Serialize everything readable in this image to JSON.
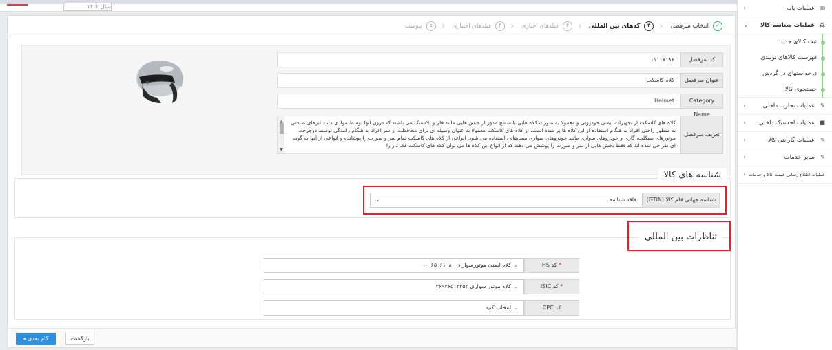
{
  "topbar": {
    "year_field": "سال ۱۴۰۲"
  },
  "sidebar": {
    "items": [
      {
        "label": "عملیات پایه",
        "icon": "chart-icon"
      },
      {
        "label": "عملیات شناسه کالا",
        "icon": "cubes-icon"
      },
      {
        "label": "عملیات تجارت داخلی",
        "icon": "edit-icon"
      },
      {
        "label": "عملیات لجستیک داخلی",
        "icon": "truck-icon"
      },
      {
        "label": "عملیات گارانتی کالا",
        "icon": "edit-icon"
      },
      {
        "label": "سایر خدمات",
        "icon": "edit-icon"
      },
      {
        "label": "عملیات اطلاع رسانی قیمت کالا و خدمات",
        "icon": ""
      }
    ],
    "sub_items": [
      "ثبت کالای جدید",
      "فهرست کالاهای تولیدی",
      "درخواستهای در گردش",
      "جستجوی کالا"
    ]
  },
  "wizard": {
    "steps": [
      {
        "num": "✓",
        "label": "انتخاب سرفصل"
      },
      {
        "num": "۲",
        "label": "کدهای بین المللی"
      },
      {
        "num": "۳",
        "label": "فیلدهای اجباری"
      },
      {
        "num": "۴",
        "label": "فیلدهای اختیاری"
      },
      {
        "num": "۵",
        "label": "پیوست"
      }
    ]
  },
  "info": {
    "code_label": "کد سرفصل",
    "code_value": "۱۱۱۱۷۱۸۶",
    "title_label": "عنوان سرفصل",
    "title_value": "کلاه کاسکت",
    "category_label": "Category Name",
    "category_value": "Helmet",
    "desc_label": "تعریف سرفصل",
    "desc_value": "کلاه های کاسکت از تجهیزات ایمنی خودرویی و معمولا به صورت کلاه هایی با سطح مدور از جنس هایی مانند فلز و پلاستیک می باشند که درون آنها توسط موادی مانند ابرهای صنعتی به منظور راحتی افراد به هنگام استفاده از این کلاه ها پر شده است. از کلاه های کاسکت معمولا به عنوان وسیله ای برای محافظت از سر افراد به هنگام رانندگی توسط دوچرخه، موتورهای سیکلت، گاری و خودروهای سواری مانند خودروهای سواری مسابقاتی استفاده می شود. انواعی از کلاه های کاسکت تمام سر و صورت را پوشانده و انواعی از آنها به گونه ای طراحی شده اند که فقط بخش هایی از سر و صورت را پوشش می دهند که از انواع این کلاه ها می توان کلاه های کاسکت فک دار را"
  },
  "identifiers": {
    "title": "شناسه های کالا",
    "gtin_label": "شناسه جهانی قلم کالا (GTIN)",
    "gtin_value": "فاقد شناسه"
  },
  "international": {
    "title": "تناظرات بین المللی",
    "hs_label": "کد HS",
    "hs_value": "کلاه ایمنی موتورسواران ۶۵۰۶۱۰۸۰ —",
    "isic_label": "کد ISIC",
    "isic_value": "کلاه موتور سواری ۳۶۹۳۶۵۱۲۳۵۲",
    "cpc_label": "کد CPC",
    "cpc_value": "انتخاب کنید"
  },
  "footer": {
    "next_label": "گام بعدی",
    "back_label": "بازگشت"
  }
}
